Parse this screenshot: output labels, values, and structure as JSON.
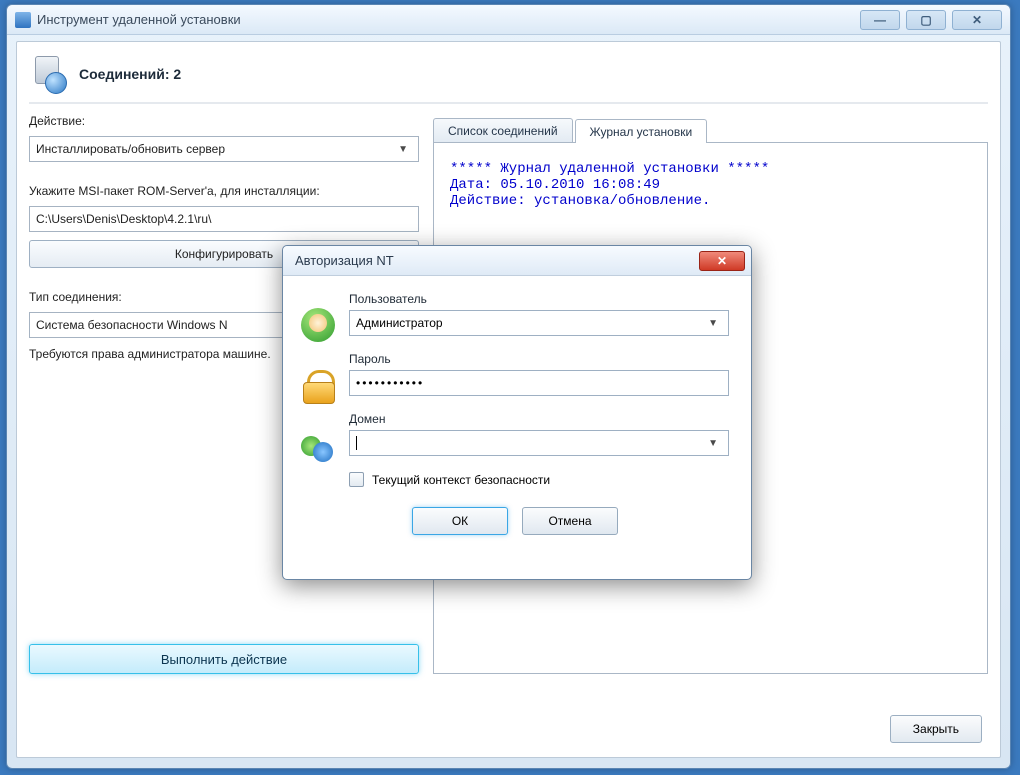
{
  "window": {
    "title": "Инструмент удаленной установки"
  },
  "header": {
    "connections_label": "Соединений:",
    "connections_count": "2"
  },
  "left_panel": {
    "action_label": "Действие:",
    "action_value": "Инсталлировать/обновить сервер",
    "msi_label": "Укажите MSI-пакет ROM-Server'а, для инсталляции:",
    "msi_path": "C:\\Users\\Denis\\Desktop\\4.2.1\\ru\\",
    "configure_btn": "Конфигурировать",
    "conn_type_label": "Тип соединения:",
    "conn_type_value": "Система безопасности Windows N",
    "note_text": "Требуются права администратора машине.",
    "execute_btn": "Выполнить действие"
  },
  "tabs": {
    "list": "Список соединений",
    "log": "Журнал установки"
  },
  "log": {
    "line1": "***** Журнал удаленной установки *****",
    "line2": "Дата: 05.10.2010 16:08:49",
    "line3": "Действие: установка/обновление."
  },
  "dialog": {
    "title": "Авторизация NT",
    "user_label": "Пользователь",
    "user_value": "Администратор",
    "password_label": "Пароль",
    "password_value": "•••••••••••",
    "domain_label": "Домен",
    "domain_value": "",
    "checkbox_label": "Текущий контекст безопасности",
    "ok": "ОК",
    "cancel": "Отмена"
  },
  "footer": {
    "close": "Закрыть"
  }
}
